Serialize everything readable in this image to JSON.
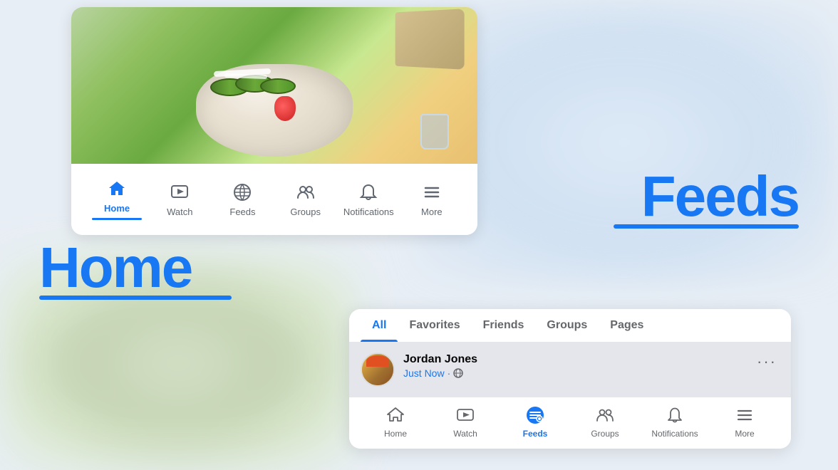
{
  "background": {
    "color": "#e8eef5"
  },
  "home_label": "Home",
  "feeds_label": "Feeds",
  "top_card": {
    "nav_items": [
      {
        "id": "home",
        "label": "Home",
        "active": true
      },
      {
        "id": "watch",
        "label": "Watch",
        "active": false
      },
      {
        "id": "feeds",
        "label": "Feeds",
        "active": false
      },
      {
        "id": "groups",
        "label": "Groups",
        "active": false
      },
      {
        "id": "notifications",
        "label": "Notifications",
        "active": false
      },
      {
        "id": "more",
        "label": "More",
        "active": false
      }
    ]
  },
  "feeds_card": {
    "tabs": [
      {
        "id": "all",
        "label": "All",
        "active": true
      },
      {
        "id": "favorites",
        "label": "Favorites",
        "active": false
      },
      {
        "id": "friends",
        "label": "Friends",
        "active": false
      },
      {
        "id": "groups",
        "label": "Groups",
        "active": false
      },
      {
        "id": "pages",
        "label": "Pages",
        "active": false
      }
    ],
    "post": {
      "author": "Jordan Jones",
      "time": "Just Now",
      "time_dot": "·",
      "more_icon": "···"
    },
    "bottom_nav": [
      {
        "id": "home",
        "label": "Home",
        "active": false
      },
      {
        "id": "watch",
        "label": "Watch",
        "active": false
      },
      {
        "id": "feeds",
        "label": "Feeds",
        "active": true
      },
      {
        "id": "groups",
        "label": "Groups",
        "active": false
      },
      {
        "id": "notifications",
        "label": "Notifications",
        "active": false
      },
      {
        "id": "more",
        "label": "More",
        "active": false
      }
    ]
  },
  "colors": {
    "primary": "#1877f2",
    "text_primary": "#050505",
    "text_secondary": "#65676b",
    "border": "#e4e6eb",
    "bg_post": "#e4e6eb"
  }
}
